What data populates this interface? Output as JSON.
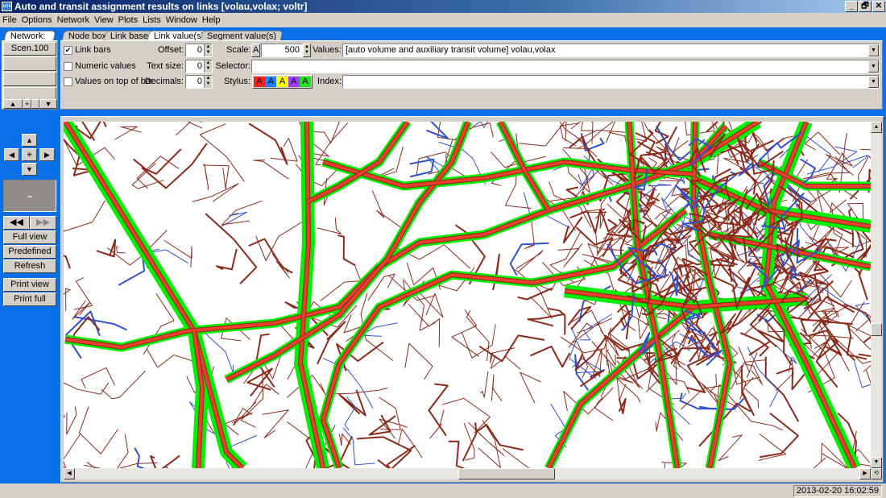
{
  "window": {
    "title": "Auto and transit assignment results on links [volau,volax;  voltr]",
    "icon": "emme-app-icon",
    "controls": [
      "_",
      "🗗",
      "✕"
    ]
  },
  "menu": [
    "File",
    "Options",
    "Network",
    "View",
    "Plots",
    "Lists",
    "Window",
    "Help"
  ],
  "left": {
    "tab": "Network:",
    "scenario": "Scen.100",
    "nav_minus": "–",
    "buttons": [
      "Full view",
      "Predefined",
      "Refresh",
      "Print view",
      "Print full"
    ]
  },
  "tabs": [
    {
      "label": "Node box"
    },
    {
      "label": "Link base"
    },
    {
      "label": "Link value(s)",
      "active": true
    },
    {
      "label": "Segment value(s)"
    }
  ],
  "controls": {
    "link_bars": {
      "label": "Link bars",
      "checked": true
    },
    "numeric_values": {
      "label": "Numeric values",
      "checked": false
    },
    "values_on_top": {
      "label": "Values on top of bar",
      "checked": false
    },
    "offset": {
      "label": "Offset:",
      "value": "0"
    },
    "text_size": {
      "label": "Text size:",
      "value": "0"
    },
    "decimals": {
      "label": "Decimals:",
      "value": "0"
    },
    "scale": {
      "label": "Scale:",
      "button": "A",
      "value": "500"
    },
    "selector": {
      "label": "Selector:",
      "value": ""
    },
    "stylus": {
      "label": "Stylus:",
      "letter": "A",
      "colors": [
        "#ff2020",
        "#2080ff",
        "#ffff00",
        "#a040ff",
        "#20e020"
      ]
    },
    "values": {
      "label": "Values:",
      "value": "[auto volume and auxiliary transit volume] volau,volax"
    },
    "index": {
      "label": "Index:",
      "value": ""
    }
  },
  "map": {
    "colors": {
      "bar": "#00ee00",
      "link": "#e8402a",
      "outline": "#8b2a1a",
      "transit": "#3050d0"
    }
  },
  "status": {
    "timestamp": "2013-02-20 16:02:59"
  }
}
